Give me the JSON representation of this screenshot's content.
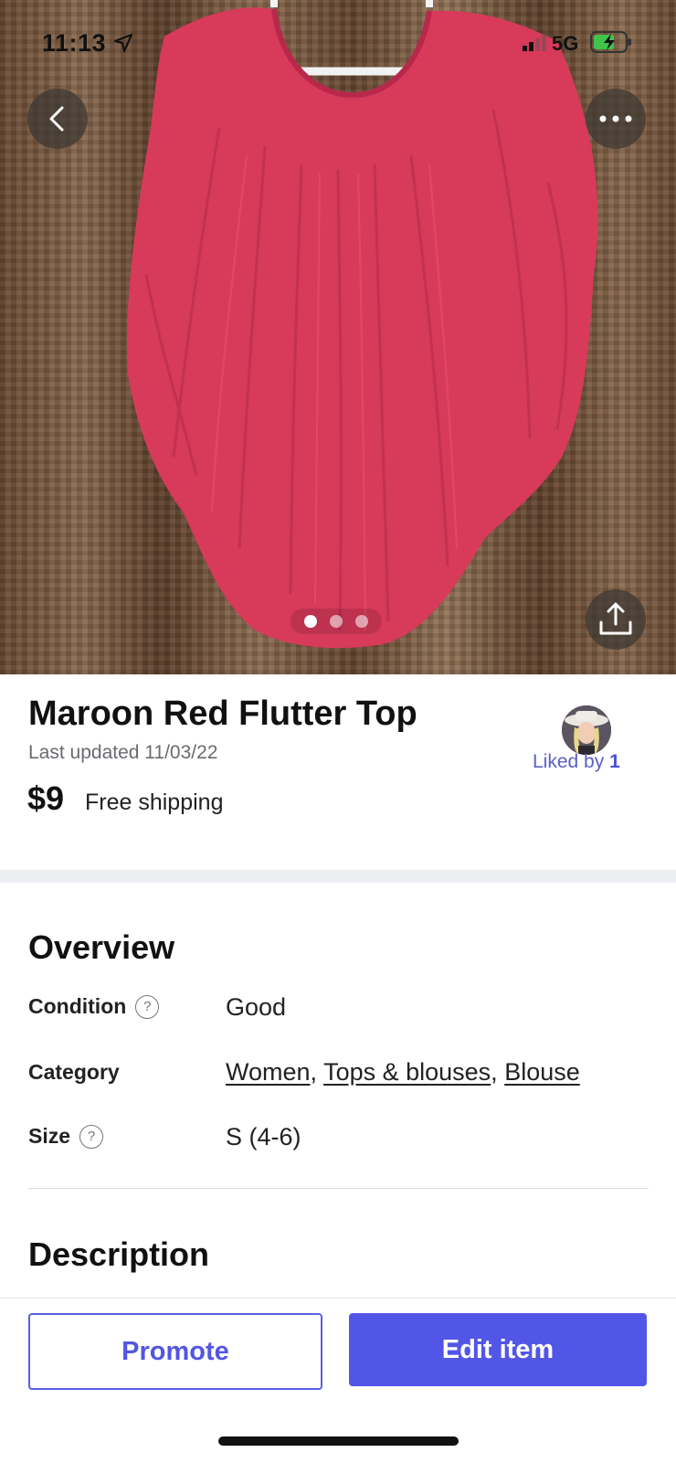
{
  "status_bar": {
    "time": "11:13",
    "network": "5G",
    "icons": [
      "location-arrow-icon",
      "signal-icon",
      "battery-charging-icon"
    ]
  },
  "gallery": {
    "image_count": 3,
    "active_index": 0,
    "garment_color": "#d83a5a"
  },
  "product": {
    "title": "Maroon Red Flutter Top",
    "last_updated": "Last updated 11/03/22",
    "price": "$9",
    "shipping": "Free shipping",
    "liked_label": "Liked by",
    "liked_count": "1"
  },
  "overview": {
    "title": "Overview",
    "condition_label": "Condition",
    "condition_value": "Good",
    "category_label": "Category",
    "category_links": [
      "Women",
      "Tops & blouses",
      "Blouse"
    ],
    "size_label": "Size",
    "size_value": "S (4-6)"
  },
  "description": {
    "title": "Description"
  },
  "actions": {
    "promote_label": "Promote",
    "edit_label": "Edit item"
  },
  "colors": {
    "accent": "#5256e6",
    "liked_text": "#5a5fc8",
    "divider": "#eceef2"
  }
}
